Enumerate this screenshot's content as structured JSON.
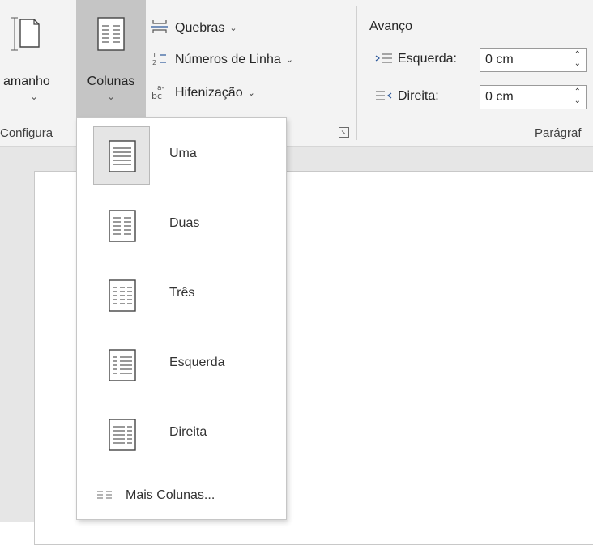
{
  "ribbon": {
    "tamanho_label": "amanho",
    "colunas_label": "Colunas",
    "chevron": "⌄",
    "quebras_label": "Quebras",
    "numeros_label": "Números de Linha",
    "hifenizacao_label": "Hifenização",
    "small_chevron": "⌄",
    "configurar_group": "Configura",
    "avanco_label": "Avanço",
    "esquerda_label": "Esquerda:",
    "direita_label": "Direita:",
    "esquerda_value": "0 cm",
    "direita_value": "0 cm",
    "paragrafo_group": "Parágraf"
  },
  "menu": {
    "items": [
      {
        "label": "Uma",
        "icon": "one-column-icon",
        "selected": true
      },
      {
        "label": "Duas",
        "icon": "two-columns-icon"
      },
      {
        "label": "Três",
        "icon": "three-columns-icon"
      },
      {
        "label": "Esquerda",
        "icon": "left-column-icon"
      },
      {
        "label": "Direita",
        "icon": "right-column-icon"
      }
    ],
    "more_prefix": "M",
    "more_rest": "ais Colunas..."
  },
  "colors": {
    "accent": "#2b579a",
    "selected_button": "#c5c5c5",
    "menu_selected": "#e5e5e5"
  }
}
